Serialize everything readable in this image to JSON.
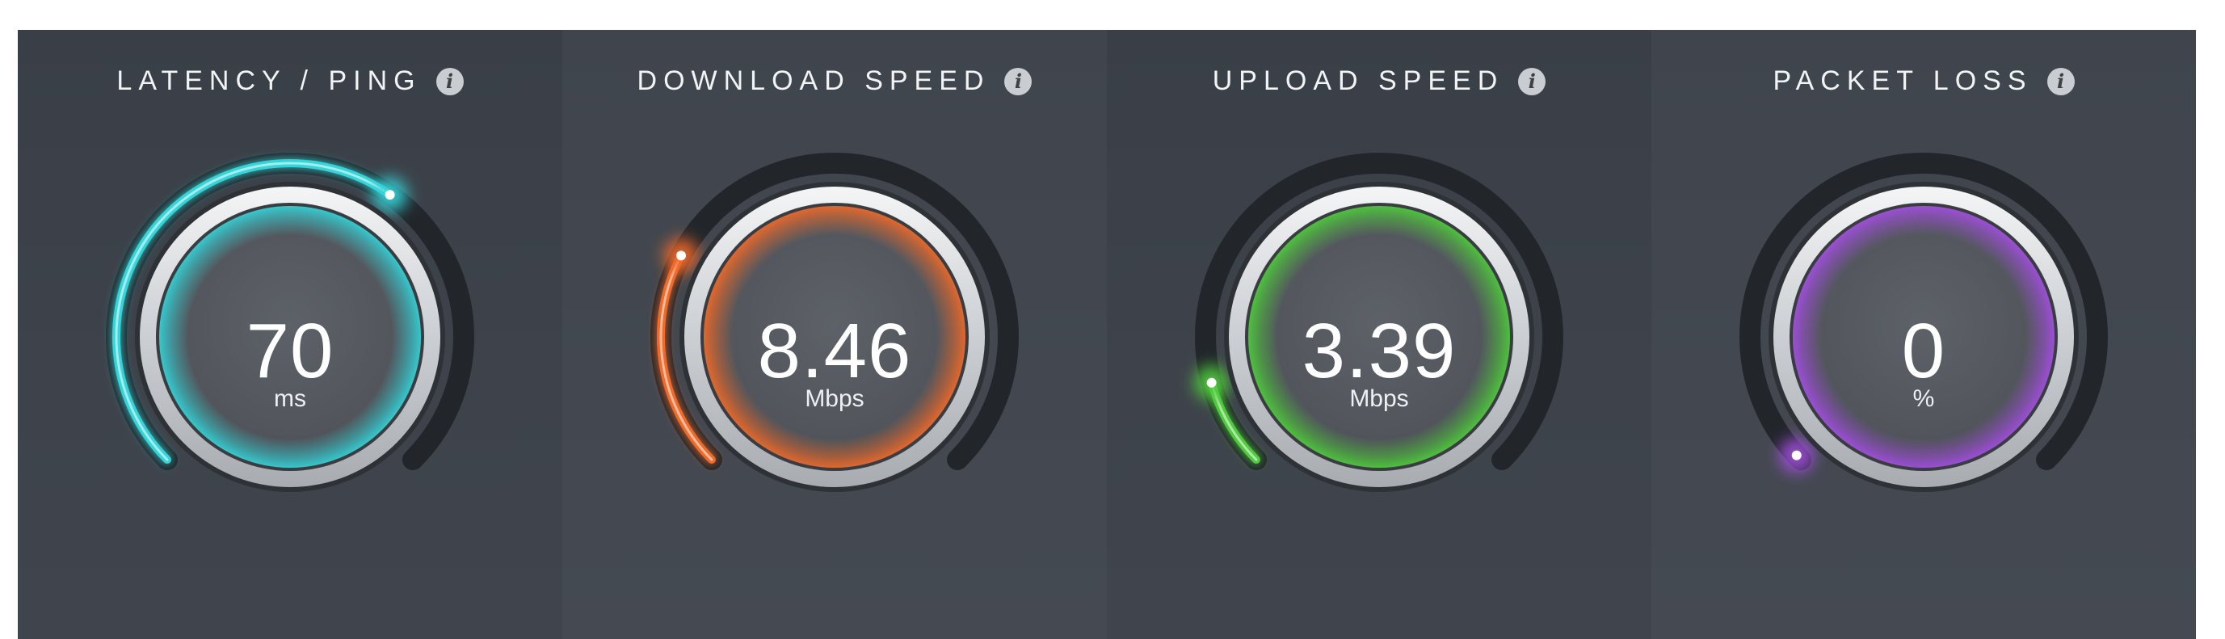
{
  "gauges": [
    {
      "title": "LATENCY / PING",
      "value": "70",
      "unit": "ms",
      "color": "#35d4d8",
      "fill_fraction": 0.63,
      "info_icon": "info-icon"
    },
    {
      "title": "DOWNLOAD SPEED",
      "value": "8.46",
      "unit": "Mbps",
      "color": "#f06a2a",
      "fill_fraction": 0.27,
      "info_icon": "info-icon"
    },
    {
      "title": "UPLOAD SPEED",
      "value": "3.39",
      "unit": "Mbps",
      "color": "#4fcb3c",
      "fill_fraction": 0.11,
      "info_icon": "info-icon"
    },
    {
      "title": "PACKET LOSS",
      "value": "0",
      "unit": "%",
      "color": "#a34fe0",
      "fill_fraction": 0.0,
      "info_icon": "info-icon"
    }
  ],
  "info_glyph": "i"
}
